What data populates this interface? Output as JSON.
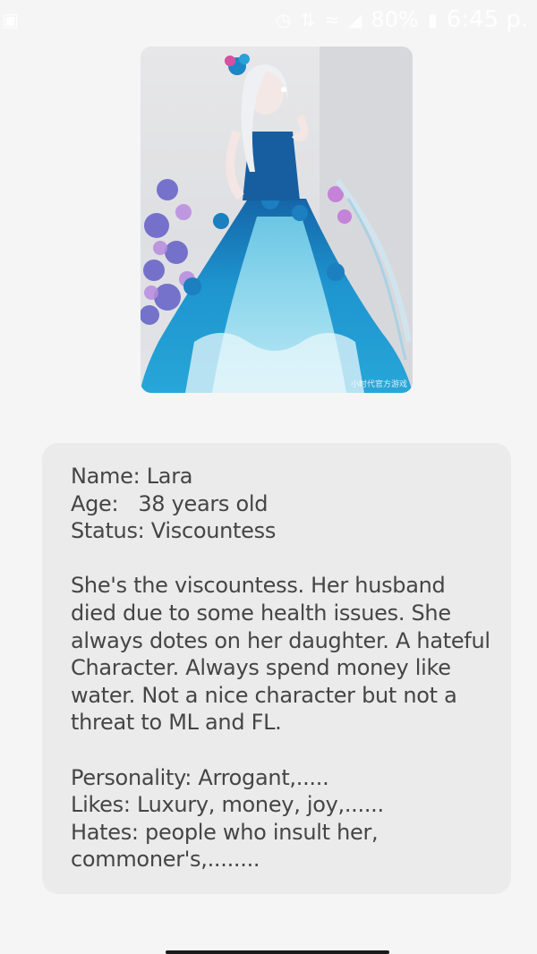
{
  "status_bar": {
    "battery_percent": "80%",
    "time": "6:45 p.",
    "icons": [
      "notification-icon",
      "alarm-icon",
      "hd-icon",
      "wifi-icon",
      "signal-icon",
      "battery-icon"
    ]
  },
  "character_image": {
    "watermark": "小时代官方游戏"
  },
  "profile": {
    "name_line": "Name: Lara",
    "age_label": "Age:",
    "age_value": "38 years old",
    "status_line": "Status: Viscountess",
    "description": [
      "She's the viscountess. Her husband",
      "died due to some health issues. She",
      "always dotes on her daughter. A hateful",
      "Character. Always spend money like",
      "water. Not a nice character but not a",
      "threat to ML and FL."
    ],
    "personality_line": "Personality: Arrogant,.....",
    "likes_line": "Likes: Luxury, money, joy,......",
    "hates_lines": [
      "Hates: people who insult her,",
      "commoner's,........"
    ]
  },
  "colors": {
    "background": "#f5f5f5",
    "card": "#ebebeb",
    "text": "#454545",
    "dress_blue": "#1e88c8"
  }
}
